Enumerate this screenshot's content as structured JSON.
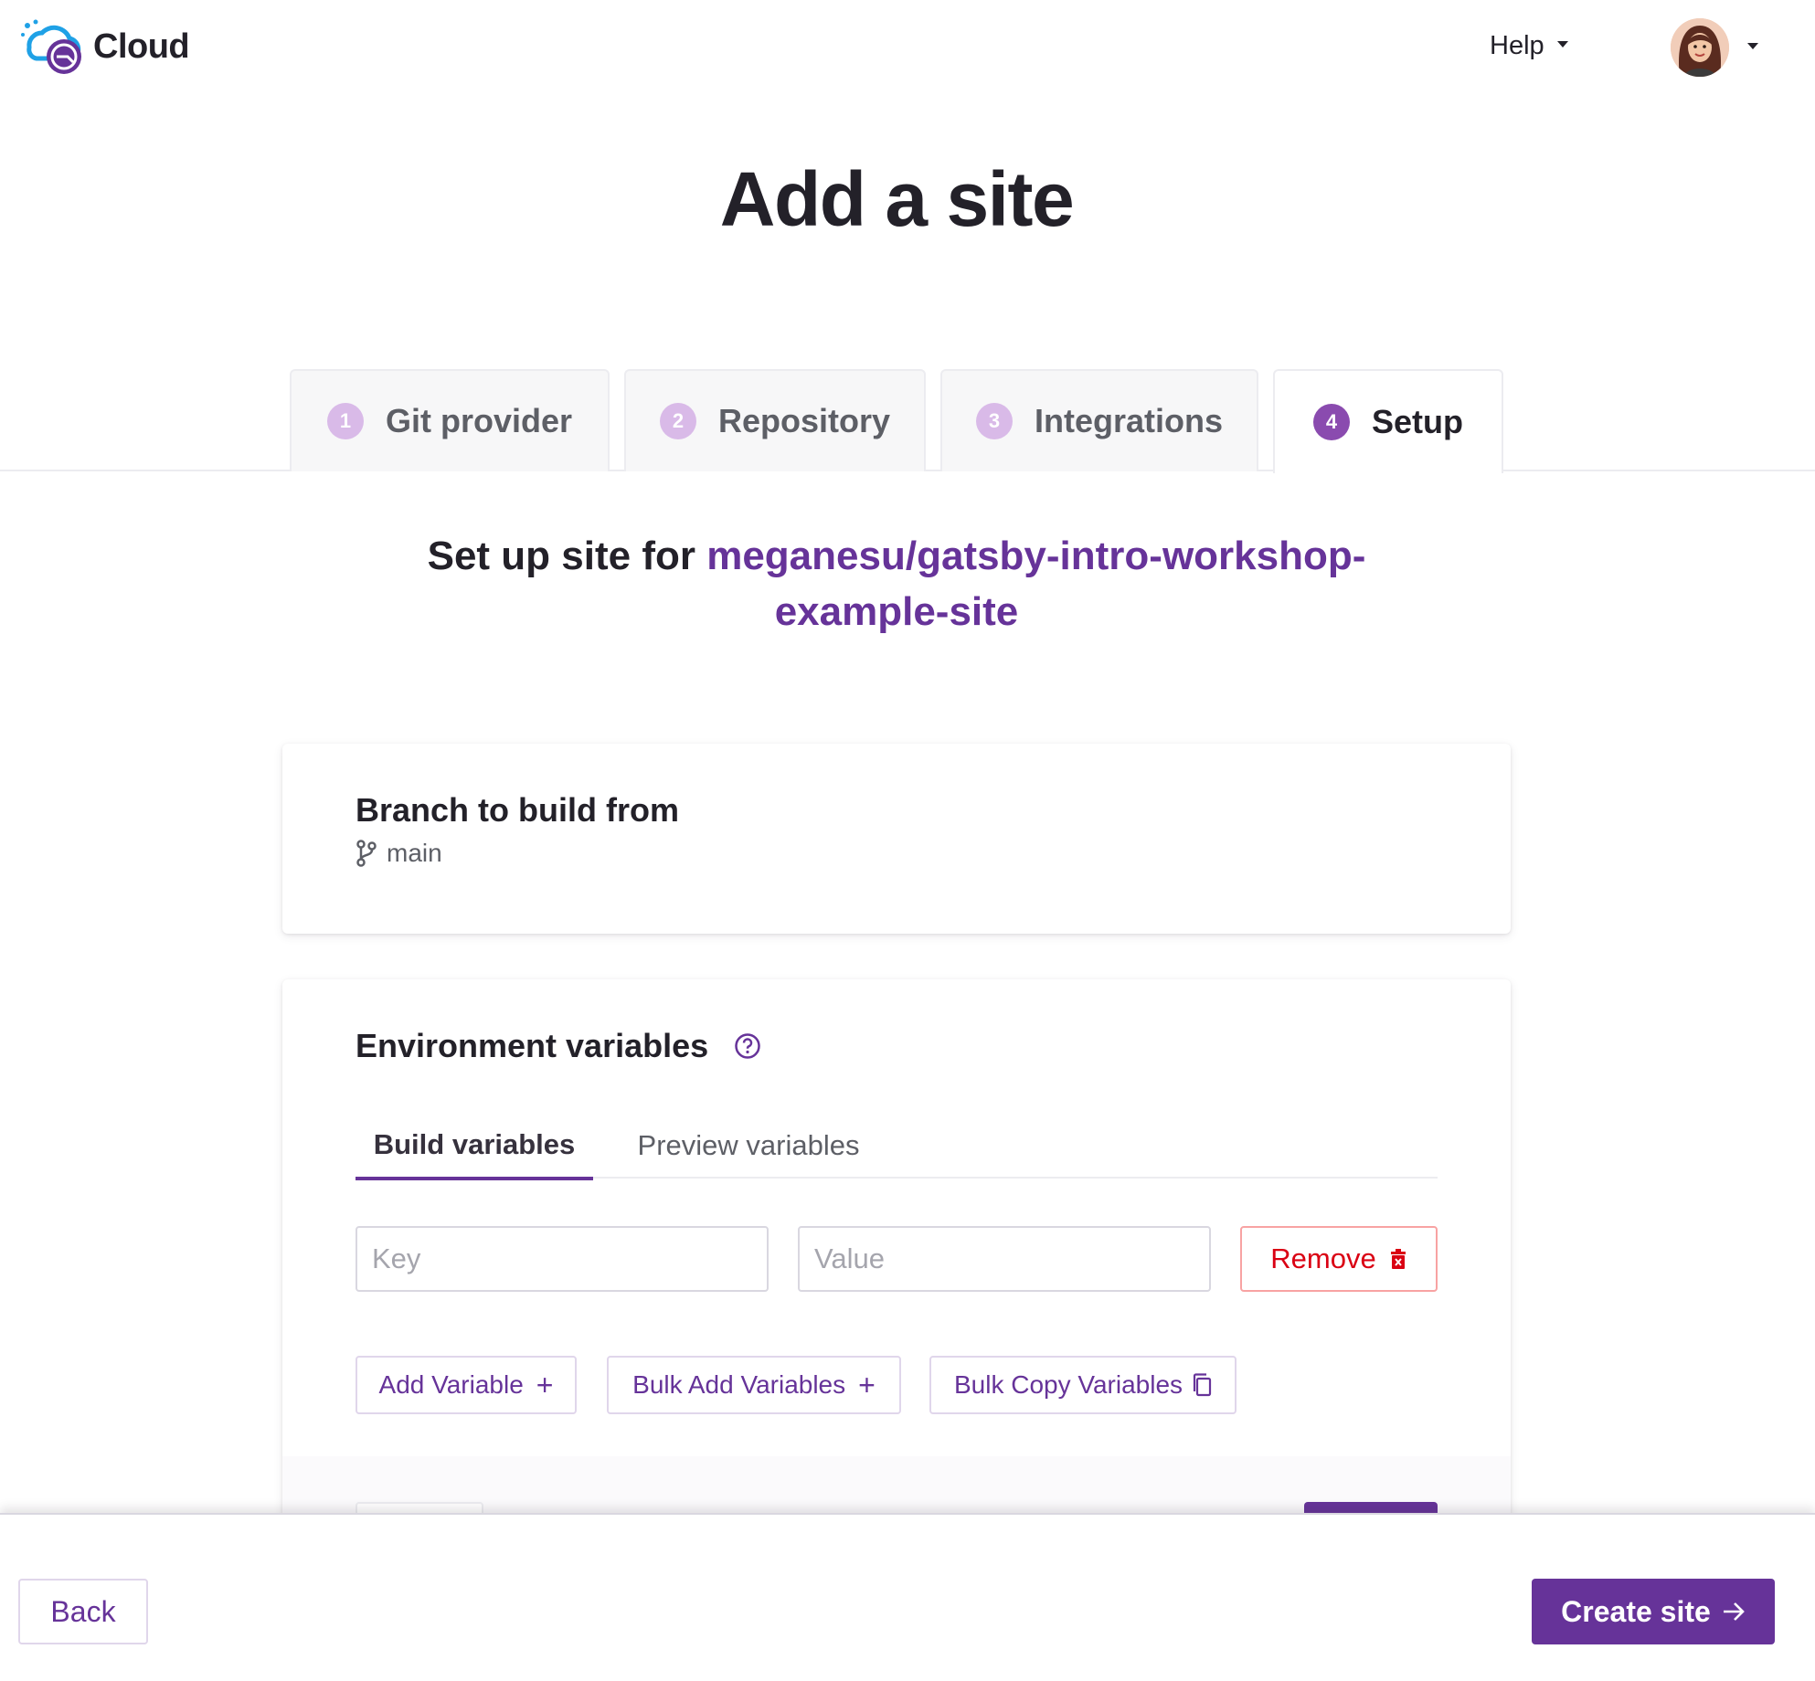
{
  "header": {
    "logo_text": "Cloud",
    "help_label": "Help",
    "avatar_icon": "user-avatar"
  },
  "page": {
    "title": "Add a site"
  },
  "steps": [
    {
      "number": "1",
      "label": "Git provider",
      "active": false
    },
    {
      "number": "2",
      "label": "Repository",
      "active": false
    },
    {
      "number": "3",
      "label": "Integrations",
      "active": false
    },
    {
      "number": "4",
      "label": "Setup",
      "active": true
    }
  ],
  "setup": {
    "heading_prefix": "Set up site for ",
    "repo_name": "meganesu/gatsby-intro-workshop-example-site"
  },
  "branch": {
    "title": "Branch to build from",
    "icon": "git-branch-icon",
    "name": "main"
  },
  "env": {
    "title": "Environment variables",
    "help_icon": "question-circle-icon",
    "tabs": [
      {
        "label": "Build variables",
        "active": true
      },
      {
        "label": "Preview variables",
        "active": false
      }
    ],
    "key_placeholder": "Key",
    "value_placeholder": "Value",
    "remove_label": "Remove",
    "add_variable_label": "Add Variable",
    "bulk_add_label": "Bulk Add Variables",
    "bulk_copy_label": "Bulk Copy Variables"
  },
  "footer": {
    "back_label": "Back",
    "create_label": "Create site"
  },
  "colors": {
    "brand_purple": "#663399",
    "step_active": "#8a4baf",
    "step_inactive": "#d9bae8",
    "danger": "#da0013"
  }
}
